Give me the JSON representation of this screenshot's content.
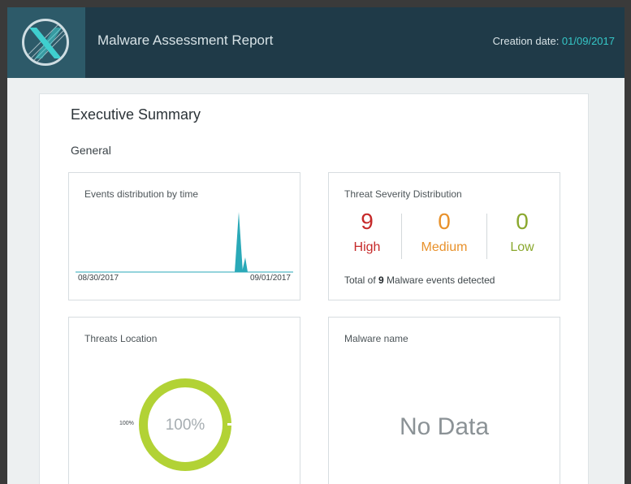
{
  "header": {
    "title": "Malware Assessment Report",
    "creation_label": "Creation date: ",
    "creation_date": "01/09/2017"
  },
  "report": {
    "executive_title": "Executive Summary",
    "section": "General"
  },
  "events_card": {
    "title": "Events distribution by time",
    "start_label": "08/30/2017",
    "end_label": "09/01/2017"
  },
  "severity_card": {
    "title": "Threat Severity Distribution",
    "items": [
      {
        "count": "9",
        "label": "High",
        "color": "#c62a2a"
      },
      {
        "count": "0",
        "label": "Medium",
        "color": "#e8912b"
      },
      {
        "count": "0",
        "label": "Low",
        "color": "#8aa82e"
      }
    ],
    "total_prefix": "Total of ",
    "total_count": "9",
    "total_suffix": " Malware events detected"
  },
  "location_card": {
    "title": "Threats Location",
    "center_value": "100%",
    "legend_value": "100%",
    "fill_percent": 100,
    "color": "#b2d235"
  },
  "malware_card": {
    "title": "Malware name",
    "empty_text": "No Data"
  },
  "colors": {
    "header_bg": "#1f3a48",
    "accent": "#35c7c7"
  }
}
